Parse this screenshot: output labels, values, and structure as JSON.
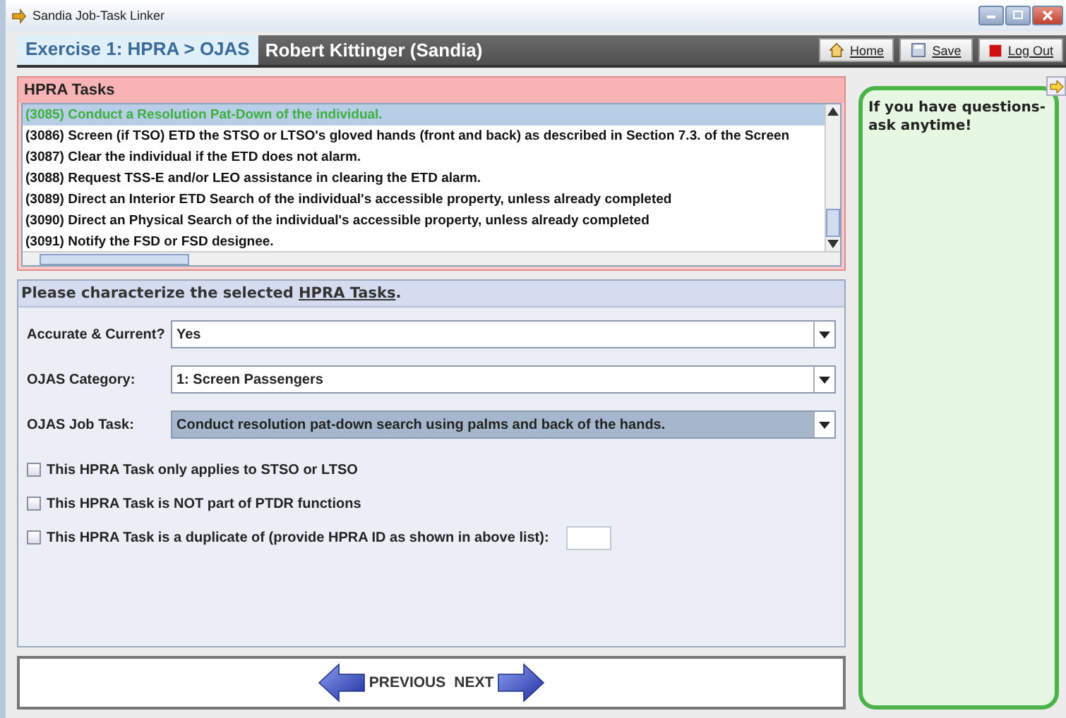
{
  "window": {
    "title": "Sandia Job-Task Linker"
  },
  "header": {
    "exercise": "Exercise 1: HPRA > OJAS",
    "user": "Robert Kittinger (Sandia)",
    "buttons": [
      {
        "label": "Home"
      },
      {
        "label": "Save"
      },
      {
        "label": "Log Out"
      }
    ]
  },
  "tasks": {
    "title": "HPRA Tasks",
    "rows": [
      {
        "text": "(3085) Conduct a Resolution Pat-Down of the individual.",
        "selected": true
      },
      {
        "text": "(3086) Screen (if TSO) ETD the STSO or LTSO's gloved hands (front and back) as described in Section 7.3. of the Screen",
        "selected": false
      },
      {
        "text": "(3087) Clear the individual if the ETD does not alarm.",
        "selected": false
      },
      {
        "text": "(3088) Request TSS-E and/or LEO assistance in clearing the ETD alarm.",
        "selected": false
      },
      {
        "text": "(3089) Direct an Interior ETD Search of the individual's accessible property, unless already completed",
        "selected": false
      },
      {
        "text": "(3090) Direct an Physical Search of the individual's accessible property, unless already completed",
        "selected": false
      },
      {
        "text": "(3091) Notify the FSD or FSD designee.",
        "selected": false
      }
    ]
  },
  "form": {
    "title": "Please characterize the selected **HPRA Tasks**.",
    "fields": [
      {
        "label": "Accurate & Current?",
        "value": "Yes",
        "focused": false
      },
      {
        "label": "OJAS Category:",
        "value": "1: Screen Passengers",
        "focused": false
      },
      {
        "label": "OJAS Job Task:",
        "value": "Conduct resolution pat-down search using palms and back of the hands.",
        "focused": true
      }
    ],
    "checks": [
      {
        "kind": "plain",
        "label": "This HPRA Task only applies to STSO or LTSO",
        "checked": false
      },
      {
        "kind": "plain",
        "label": "This HPRA Task is NOT part of PTDR functions",
        "checked": false
      },
      {
        "kind": "with_input",
        "label": "This HPRA Task is a duplicate of (provide HPRA ID as shown in above list):",
        "checked": false
      }
    ]
  },
  "nav": {
    "previous": "PREVIOUS",
    "next": "NEXT"
  },
  "help": {
    "text": "If you have questions-\nask anytime!"
  }
}
